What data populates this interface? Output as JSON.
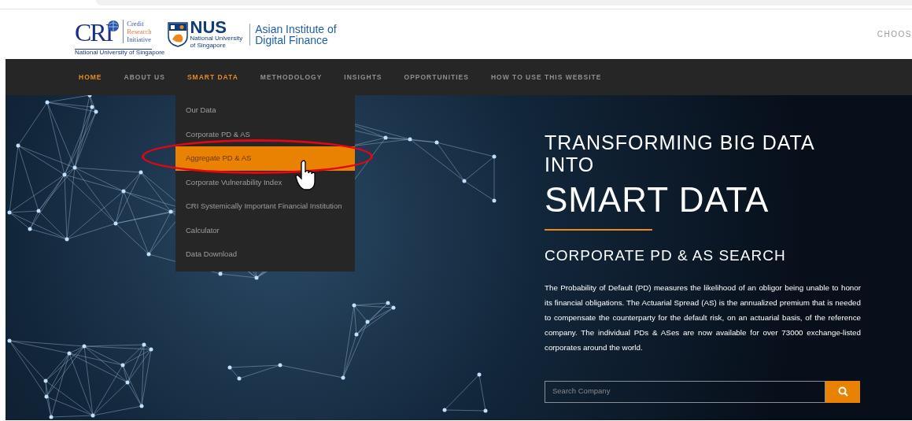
{
  "header": {
    "cri_logo": {
      "mark": "CRI",
      "lines": [
        "Credit",
        "Research",
        "Initiative"
      ],
      "caption": "National University of Singapore"
    },
    "nus_logo": {
      "mark": "NUS",
      "caption_lines": [
        "National University",
        "of Singapore"
      ]
    },
    "institute_lines": [
      "Asian Institute of",
      "Digital Finance"
    ],
    "language_label": "CHOOS"
  },
  "nav": [
    {
      "label": "HOME",
      "highlighted": true
    },
    {
      "label": "ABOUT US",
      "highlighted": false
    },
    {
      "label": "SMART DATA",
      "highlighted": true
    },
    {
      "label": "METHODOLOGY",
      "highlighted": false
    },
    {
      "label": "INSIGHTS",
      "highlighted": false
    },
    {
      "label": "OPPORTUNITIES",
      "highlighted": false
    },
    {
      "label": "HOW TO USE THIS WEBSITE",
      "highlighted": false
    }
  ],
  "dropdown": [
    {
      "label": "Our Data",
      "highlighted": false
    },
    {
      "label": "Corporate PD & AS",
      "highlighted": false
    },
    {
      "label": "Aggregate PD & AS",
      "highlighted": true
    },
    {
      "label": "Corporate Vulnerability Index",
      "highlighted": false
    },
    {
      "label": "CRI Systemically Important Financial Institution",
      "highlighted": false
    },
    {
      "label": "Calculator",
      "highlighted": false
    },
    {
      "label": "Data Download",
      "highlighted": false
    }
  ],
  "hero": {
    "kicker": "TRANSFORMING BIG DATA INTO",
    "headline": "SMART DATA",
    "subheading": "CORPORATE PD & AS SEARCH",
    "description": "The Probability of Default (PD) measures the likelihood of an obligor being unable to honor its financial obligations. The Actuarial Spread (AS) is the annualized premium that is needed to compensate the counterparty for the default risk, on an actuarial basis, of the reference company. The individual PDs & ASes are now available for over 73000 exchange-listed corporates around the world.",
    "search": {
      "placeholder": "Search Company"
    }
  }
}
